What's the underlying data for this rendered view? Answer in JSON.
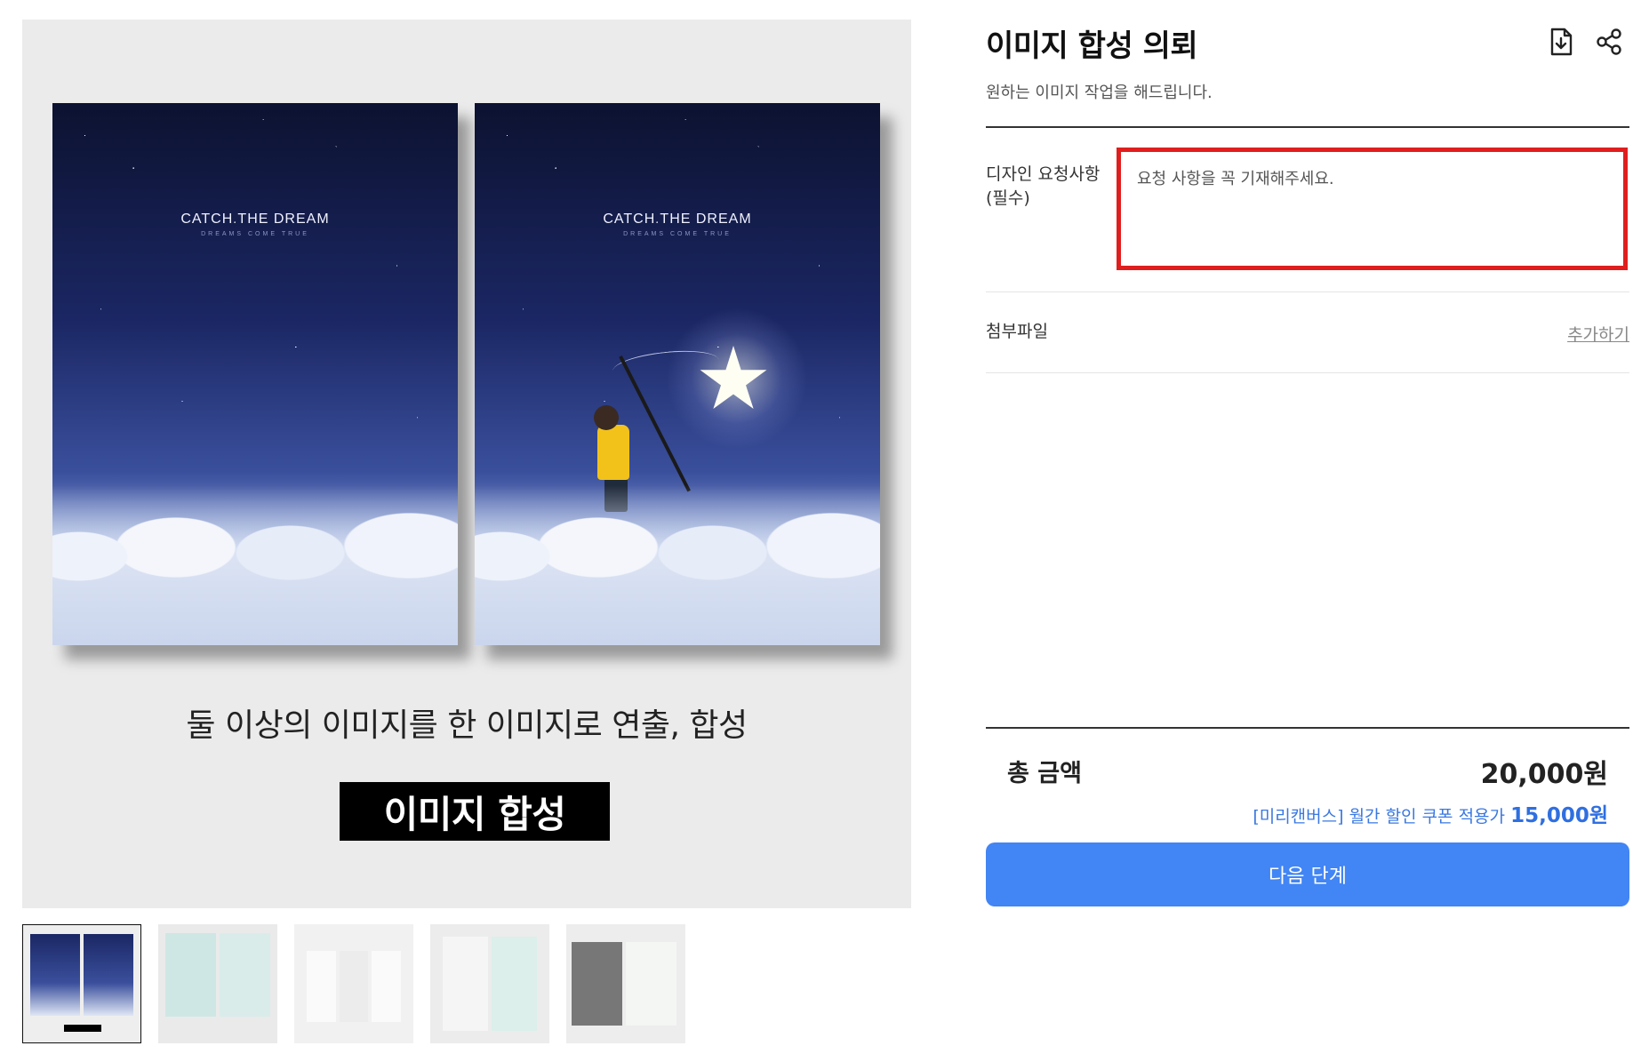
{
  "product": {
    "title": "이미지 합성 의뢰",
    "subtitle": "원하는 이미지 작업을 해드립니다.",
    "download_icon": "download-file-icon",
    "share_icon": "share-icon"
  },
  "image": {
    "poster_title": "CATCH THE DREAM",
    "poster_subtitle": "DREAMS COME TRUE",
    "caption": "둘 이상의 이미지를 한 이미지로 연출, 합성",
    "caption_box": "이미지 합성"
  },
  "thumbnails": [
    {
      "label": "thumbnail-1",
      "active": true
    },
    {
      "label": "thumbnail-2",
      "active": false
    },
    {
      "label": "thumbnail-3",
      "active": false
    },
    {
      "label": "thumbnail-4",
      "active": false
    },
    {
      "label": "thumbnail-5",
      "active": false
    }
  ],
  "form": {
    "design_request_label_line1": "디자인 요청사항",
    "design_request_label_line2": "(필수)",
    "design_request_placeholder": "요청 사항을 꼭 기재해주세요.",
    "attachment_label": "첨부파일",
    "attachment_action": "추가하기"
  },
  "summary": {
    "total_label": "총 금액",
    "total_value": "20,000원",
    "coupon_text": "[미리캔버스] 월간 할인 쿠폰 적용가",
    "coupon_price": "15,000원",
    "next_button": "다음 단계"
  },
  "colors": {
    "accent": "#4285f4",
    "highlight_border": "#e01e1e",
    "coupon": "#3a78e0"
  }
}
